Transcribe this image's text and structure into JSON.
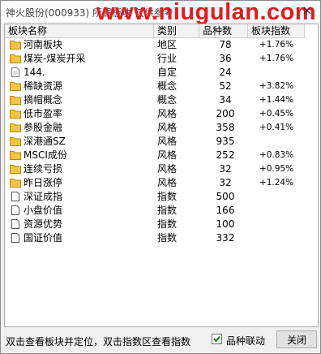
{
  "window": {
    "title": "神火股份(000933) 所属板块 仅供参考",
    "watermark": "www.niugulan.com",
    "close_glyph": "×"
  },
  "columns": [
    "板块名称",
    "类别",
    "品种数",
    "板块指数"
  ],
  "rows": [
    {
      "icon": "folder-icon",
      "name": "河南板块",
      "type": "地区",
      "count": "78",
      "index": "+1.76%"
    },
    {
      "icon": "folder-icon",
      "name": "煤炭-煤炭开采",
      "type": "行业",
      "count": "36",
      "index": "+1.76%"
    },
    {
      "icon": "document-icon",
      "name": "144.",
      "type": "自定",
      "count": "24",
      "index": ""
    },
    {
      "icon": "folder-icon",
      "name": "稀缺资源",
      "type": "概念",
      "count": "52",
      "index": "+3.82%"
    },
    {
      "icon": "folder-icon",
      "name": "摘帽概念",
      "type": "概念",
      "count": "34",
      "index": "+1.44%"
    },
    {
      "icon": "folder-icon",
      "name": "低市盈率",
      "type": "风格",
      "count": "200",
      "index": "+0.45%"
    },
    {
      "icon": "folder-icon",
      "name": "参股金融",
      "type": "风格",
      "count": "358",
      "index": "+0.41%"
    },
    {
      "icon": "folder-icon",
      "name": "深港通SZ",
      "type": "风格",
      "count": "935",
      "index": ""
    },
    {
      "icon": "folder-icon",
      "name": "MSCI成份",
      "type": "风格",
      "count": "252",
      "index": "+0.83%"
    },
    {
      "icon": "folder-icon",
      "name": "连续亏损",
      "type": "风格",
      "count": "32",
      "index": "+0.95%"
    },
    {
      "icon": "folder-icon",
      "name": "昨日涨停",
      "type": "风格",
      "count": "32",
      "index": "+1.24%"
    },
    {
      "icon": "index-doc-icon",
      "name": "深证成指",
      "type": "指数",
      "count": "500",
      "index": ""
    },
    {
      "icon": "index-doc-icon",
      "name": "小盘价值",
      "type": "指数",
      "count": "166",
      "index": ""
    },
    {
      "icon": "index-doc-icon",
      "name": "资源优势",
      "type": "指数",
      "count": "100",
      "index": ""
    },
    {
      "icon": "index-doc-icon",
      "name": "国证价值",
      "type": "指数",
      "count": "332",
      "index": ""
    }
  ],
  "status": {
    "hint": "双击查看板块并定位，双击指数区查看指数",
    "checkbox_label": "品种联动",
    "checkbox_checked": true,
    "close_button": "关闭"
  },
  "colors": {
    "watermark": "#e5191e",
    "folder_fill": "#f5c542",
    "checkmark": "#1a7a1a"
  }
}
